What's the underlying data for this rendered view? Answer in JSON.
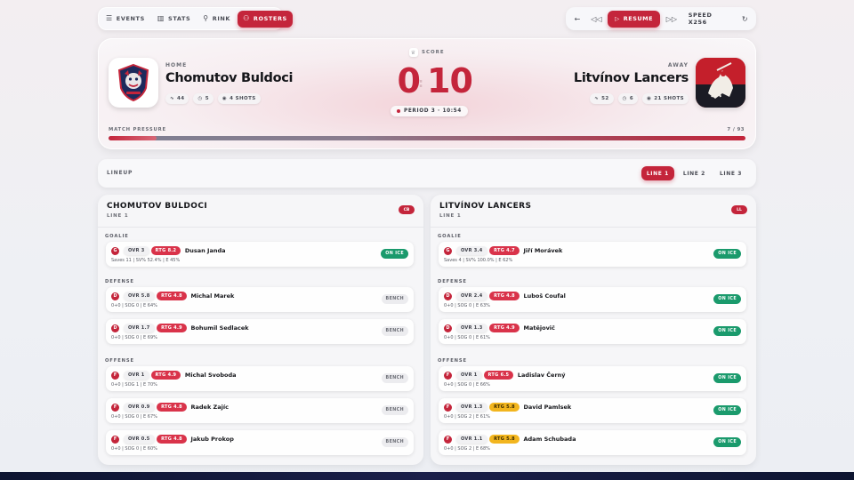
{
  "nav": {
    "items": [
      {
        "label": "EVENTS",
        "icon": "list-icon",
        "active": false
      },
      {
        "label": "STATS",
        "icon": "bar-chart-icon",
        "active": false
      },
      {
        "label": "RINK",
        "icon": "skater-icon",
        "active": false
      },
      {
        "label": "ROSTERS",
        "icon": "users-icon",
        "active": true
      }
    ]
  },
  "controls": {
    "resume_label": "RESUME",
    "speed_label": "SPEED X256"
  },
  "scoreboard": {
    "score_label": "SCORE",
    "home": {
      "side": "HOME",
      "name": "Chomutov Buldoci",
      "stats": [
        "44",
        "5",
        "4 SHOTS"
      ],
      "score": "0"
    },
    "away": {
      "side": "AWAY",
      "name": "Litvínov Lancers",
      "stats": [
        "52",
        "6",
        "21 SHOTS"
      ],
      "score": "10"
    },
    "period": "PERIOD 3 · 10:54",
    "pressure_label": "MATCH PRESSURE",
    "pressure_value": "7 / 93",
    "pressure_fraction": 0.075,
    "accent_color": "#c4253b"
  },
  "lineup": {
    "title": "LINEUP",
    "tabs": [
      "LINE 1",
      "LINE 2",
      "LINE 3"
    ],
    "active_tab": "LINE 1"
  },
  "teams": [
    {
      "name": "CHOMUTOV BULDOCI",
      "line": "LINE 1",
      "badge": "CB",
      "sections": {
        "goalie": "GOALIE",
        "defense": "DEFENSE",
        "offense": "OFFENSE"
      },
      "goalie": [
        {
          "pos": "G",
          "ovr": "OVR 3",
          "rtg": "RTG 8.2",
          "rtg_color": "red",
          "name": "Dusan Janda",
          "stats": "Saves 11 | SV% 52.4% | E 45%",
          "status": "ON ICE"
        }
      ],
      "defense": [
        {
          "pos": "D",
          "ovr": "OVR 5.8",
          "rtg": "RTG 4.8",
          "rtg_color": "red",
          "name": "Michal Marek",
          "stats": "0+0 | SOG 0 | E 64%",
          "status": "BENCH"
        },
        {
          "pos": "D",
          "ovr": "OVR 1.7",
          "rtg": "RTG 4.9",
          "rtg_color": "red",
          "name": "Bohumil Sedlacek",
          "stats": "0+0 | SOG 0 | E 69%",
          "status": "BENCH"
        }
      ],
      "offense": [
        {
          "pos": "F",
          "ovr": "OVR 1",
          "rtg": "RTG 4.9",
          "rtg_color": "red",
          "name": "Michal Svoboda",
          "stats": "0+0 | SOG 1 | E 70%",
          "status": "BENCH"
        },
        {
          "pos": "F",
          "ovr": "OVR 0.9",
          "rtg": "RTG 4.8",
          "rtg_color": "red",
          "name": "Radek Zajíc",
          "stats": "0+0 | SOG 0 | E 67%",
          "status": "BENCH"
        },
        {
          "pos": "F",
          "ovr": "OVR 0.5",
          "rtg": "RTG 4.8",
          "rtg_color": "red",
          "name": "Jakub Prokop",
          "stats": "0+0 | SOG 0 | E 60%",
          "status": "BENCH"
        }
      ]
    },
    {
      "name": "LITVÍNOV LANCERS",
      "line": "LINE 1",
      "badge": "LL",
      "sections": {
        "goalie": "GOALIE",
        "defense": "DEFENSE",
        "offense": "OFFENSE"
      },
      "goalie": [
        {
          "pos": "G",
          "ovr": "OVR 3.4",
          "rtg": "RTG 4.7",
          "rtg_color": "red",
          "name": "Jiří Morávek",
          "stats": "Saves 4 | SV% 100.0% | E 62%",
          "status": "ON ICE"
        }
      ],
      "defense": [
        {
          "pos": "D",
          "ovr": "OVR 2.4",
          "rtg": "RTG 4.8",
          "rtg_color": "red",
          "name": "Luboš Coufal",
          "stats": "0+0 | SOG 0 | E 63%",
          "status": "ON ICE"
        },
        {
          "pos": "D",
          "ovr": "OVR 1.3",
          "rtg": "RTG 4.9",
          "rtg_color": "red",
          "name": "Matějovič",
          "stats": "0+0 | SOG 0 | E 61%",
          "status": "ON ICE"
        }
      ],
      "offense": [
        {
          "pos": "F",
          "ovr": "OVR 1",
          "rtg": "RTG 6.5",
          "rtg_color": "red",
          "name": "Ladislav Černý",
          "stats": "0+0 | SOG 0 | E 66%",
          "status": "ON ICE"
        },
        {
          "pos": "F",
          "ovr": "OVR 1.3",
          "rtg": "RTG 5.8",
          "rtg_color": "gold",
          "name": "David Pamlsek",
          "stats": "0+0 | SOG 2 | E 61%",
          "status": "ON ICE"
        },
        {
          "pos": "F",
          "ovr": "OVR 1.1",
          "rtg": "RTG 5.8",
          "rtg_color": "gold",
          "name": "Adam Schubada",
          "stats": "0+0 | SOG 2 | E 68%",
          "status": "ON ICE"
        }
      ]
    }
  ]
}
